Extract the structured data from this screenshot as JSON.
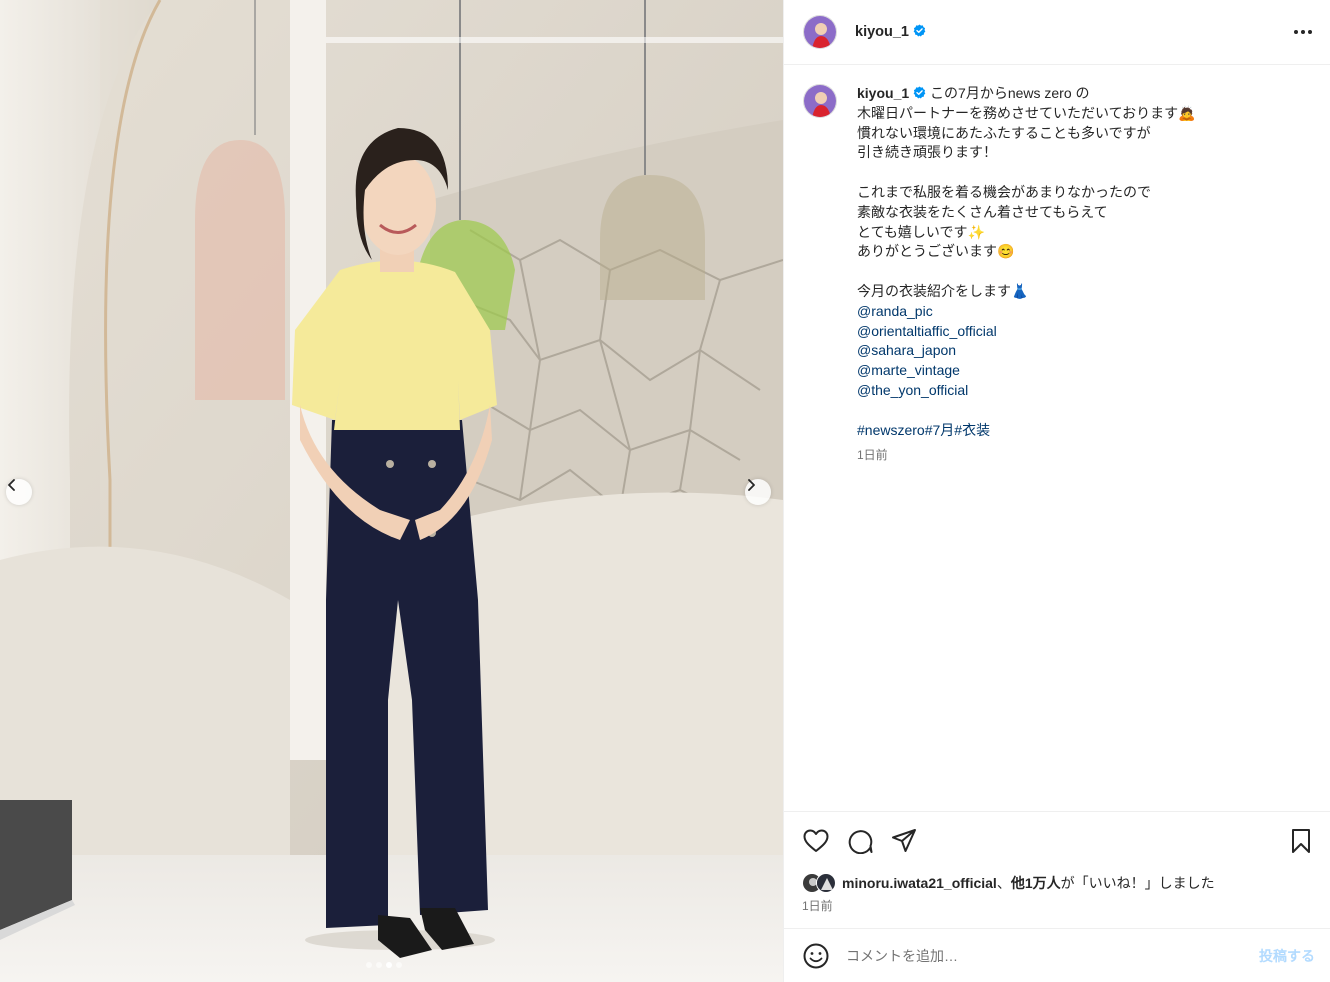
{
  "post": {
    "username": "kiyou_1",
    "verified": true,
    "caption_first": "この7月からnews zero の",
    "caption_lines": [
      "木曜日パートナーを務めさせていただいております🙇",
      "慣れない環境にあたふたすることも多いですが",
      "引き続き頑張ります！",
      "",
      "これまで私服を着る機会があまりなかったので",
      "素敵な衣装をたくさん着させてもらえて",
      "とても嬉しいです✨",
      "ありがとうございます😊",
      "",
      "今月の衣装紹介をします👗"
    ],
    "mentions": [
      "@randa_pic",
      "@orientaltiaffic_official",
      "@sahara_japon",
      "@marte_vintage",
      "@the_yon_official"
    ],
    "hashtags": [
      "#newszero",
      "#7月",
      "#衣装"
    ],
    "caption_time": "1日前"
  },
  "likes": {
    "liker": "minoru.iwata21_official",
    "separator": "、",
    "others": "他1万人",
    "suffix": "が「いいね！」しました",
    "time": "1日前"
  },
  "comment": {
    "placeholder": "コメントを追加…",
    "post_label": "投稿する"
  },
  "carousel": {
    "slide_count": 4,
    "active_index": 2
  },
  "icons": {
    "more": "more-options-icon",
    "like": "heart-icon",
    "comment": "comment-icon",
    "share": "share-icon",
    "save": "bookmark-icon",
    "emoji": "emoji-icon",
    "prev": "chevron-left-icon",
    "next": "chevron-right-icon"
  },
  "colors": {
    "link": "#00376b",
    "verified": "#0095f6",
    "post_disabled": "#b3dbff"
  }
}
